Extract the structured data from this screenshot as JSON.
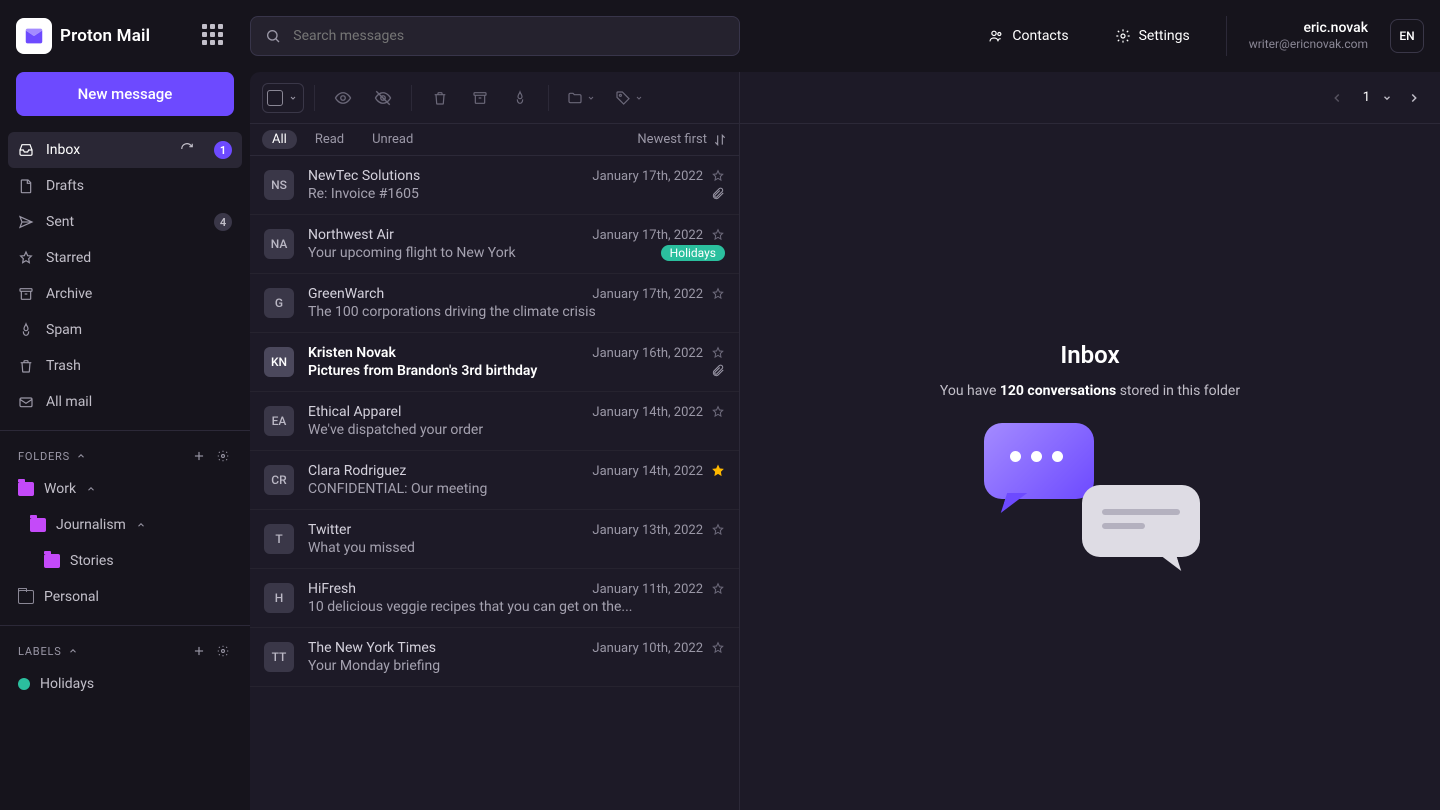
{
  "brand": {
    "name": "Proton Mail"
  },
  "header": {
    "search_placeholder": "Search messages",
    "contacts": "Contacts",
    "settings": "Settings",
    "user_name": "eric.novak",
    "user_email": "writer@ericnovak.com",
    "language": "EN"
  },
  "compose_label": "New message",
  "nav": {
    "inbox": "Inbox",
    "inbox_badge": "1",
    "drafts": "Drafts",
    "sent": "Sent",
    "sent_badge": "4",
    "starred": "Starred",
    "archive": "Archive",
    "spam": "Spam",
    "trash": "Trash",
    "allmail": "All mail"
  },
  "sections": {
    "folders": "FOLDERS",
    "labels": "LABELS"
  },
  "folders": {
    "work": "Work",
    "journalism": "Journalism",
    "stories": "Stories",
    "personal": "Personal"
  },
  "labels": {
    "holidays": {
      "name": "Holidays",
      "color": "#2bbf9e"
    }
  },
  "filters": {
    "all": "All",
    "read": "Read",
    "unread": "Unread",
    "sort": "Newest first"
  },
  "page": "1",
  "messages": [
    {
      "avatar": "NS",
      "from": "NewTec Solutions",
      "subject": "Re: Invoice #1605",
      "date": "January 17th, 2022",
      "attachment": true
    },
    {
      "avatar": "NA",
      "from": "Northwest Air",
      "subject": "Your upcoming flight to New York",
      "date": "January 17th, 2022",
      "tag": "Holidays",
      "tag_color": "#2bbf9e"
    },
    {
      "avatar": "G",
      "from": "GreenWarch",
      "subject": "The 100 corporations driving the climate crisis",
      "date": "January 17th, 2022"
    },
    {
      "avatar": "KN",
      "from": "Kristen Novak",
      "subject": "Pictures from Brandon's 3rd birthday",
      "date": "January 16th, 2022",
      "attachment": true,
      "unread": true
    },
    {
      "avatar": "EA",
      "from": "Ethical Apparel",
      "subject": "We've dispatched your order",
      "date": "January 14th, 2022"
    },
    {
      "avatar": "CR",
      "from": "Clara Rodriguez",
      "subject": "CONFIDENTIAL: Our meeting",
      "date": "January 14th, 2022",
      "starred": true
    },
    {
      "avatar": "T",
      "from": "Twitter",
      "subject": "What you missed",
      "date": "January 13th, 2022"
    },
    {
      "avatar": "H",
      "from": "HiFresh",
      "subject": "10 delicious veggie recipes that you can get on the...",
      "date": "January 11th, 2022"
    },
    {
      "avatar": "TT",
      "from": "The New York Times",
      "subject": "Your Monday briefing",
      "date": "January 10th, 2022"
    }
  ],
  "reader": {
    "title": "Inbox",
    "sub_pre": "You have ",
    "sub_bold": "120 conversations",
    "sub_post": " stored in this folder"
  }
}
